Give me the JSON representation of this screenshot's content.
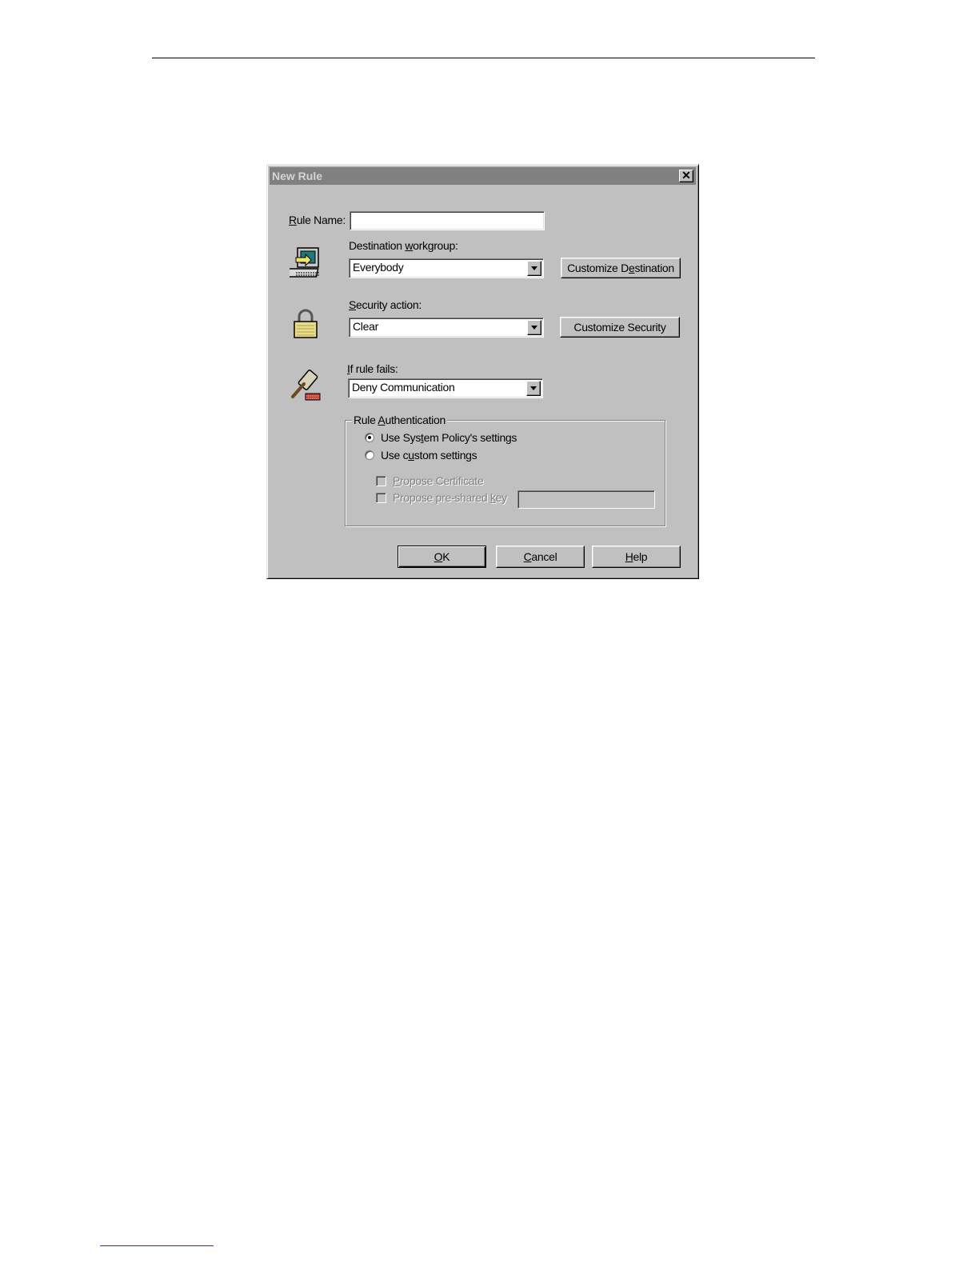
{
  "dialog": {
    "title": "New Rule",
    "close_glyph": "✕"
  },
  "rule_name": {
    "label_u": "R",
    "label_rest": "ule Name:",
    "value": ""
  },
  "destination": {
    "label_pre": "Destination ",
    "label_u": "w",
    "label_rest": "orkgroup:",
    "value": "Everybody",
    "icon": "computer-icon",
    "button_pre": "Customize D",
    "button_u": "e",
    "button_rest": "stination"
  },
  "security": {
    "label_u": "S",
    "label_rest": "ecurity action:",
    "value": "Clear",
    "icon": "lock-icon",
    "button_label": "Customize Security"
  },
  "failure": {
    "label_u": "I",
    "label_rest": "f rule fails:",
    "value": "Deny Communication",
    "icon": "gavel-icon"
  },
  "authentication": {
    "group_pre": "Rule ",
    "group_u": "A",
    "group_rest": "uthentication",
    "radio_system_pre": "Use Sys",
    "radio_system_u": "t",
    "radio_system_rest": "em Policy's settings",
    "radio_custom_pre": "Use c",
    "radio_custom_u": "u",
    "radio_custom_rest": "stom settings",
    "selected": "system",
    "propose_cert_u": "P",
    "propose_cert_rest": "ropose Certificate",
    "propose_key_pre": "Propose pre-shared ",
    "propose_key_u": "k",
    "propose_key_rest": "ey",
    "propose_key_value": ""
  },
  "buttons": {
    "ok_u": "O",
    "ok_rest": "K",
    "cancel_u": "C",
    "cancel_rest": "ancel",
    "help_u": "H",
    "help_rest": "elp"
  }
}
